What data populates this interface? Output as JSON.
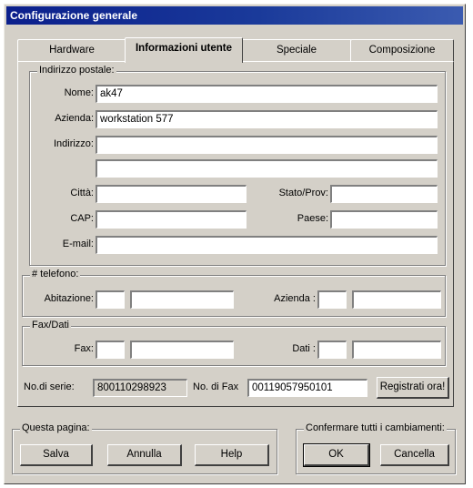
{
  "window": {
    "title": "Configurazione generale"
  },
  "tabs": [
    {
      "label": "Hardware",
      "active": false
    },
    {
      "label": "Informazioni utente",
      "active": true
    },
    {
      "label": "Speciale",
      "active": false
    },
    {
      "label": "Composizione",
      "active": false
    }
  ],
  "postal": {
    "group_label": "Indirizzo postale:",
    "name_label": "Nome:",
    "name_value": "ak47",
    "company_label": "Azienda:",
    "company_value": "workstation 577",
    "address_label": "Indirizzo:",
    "address_value_1": "",
    "address_value_2": "",
    "city_label": "Città:",
    "city_value": "",
    "state_label": "Stato/Prov:",
    "state_value": "",
    "zip_label": "CAP:",
    "zip_value": "",
    "country_label": "Paese:",
    "country_value": "",
    "email_label": "E-mail:",
    "email_value": ""
  },
  "phone": {
    "group_label": "# telefono:",
    "home_label": "Abitazione:",
    "company_label": "Azienda :"
  },
  "fax": {
    "group_label": "Fax/Dati",
    "fax_label": "Fax:",
    "data_label": "Dati :"
  },
  "serial": {
    "serial_label": "No.di serie:",
    "serial_value": "800110298923",
    "fax_no_label": "No. di Fax",
    "fax_no_value": "00119057950101",
    "register_button": "Registrati ora!"
  },
  "page_group": {
    "label": "Questa pagina:",
    "save": "Salva",
    "cancel": "Annulla",
    "help": "Help"
  },
  "confirm_group": {
    "label": "Confermare tutti i cambiamenti:",
    "ok": "OK",
    "cancel": "Cancella"
  }
}
